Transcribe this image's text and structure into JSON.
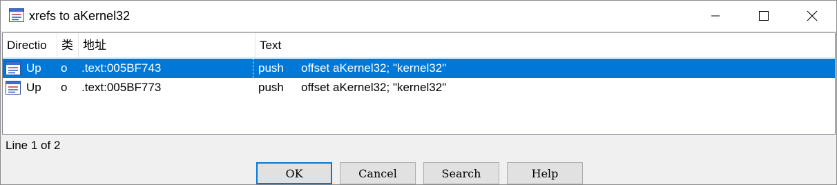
{
  "window": {
    "title": "xrefs to aKernel32",
    "icon": "xref-list-icon"
  },
  "columns": {
    "direction": "Directio",
    "type": "类",
    "address": "地址",
    "text": "Text"
  },
  "rows": [
    {
      "direction": "Up",
      "type": "o",
      "address": ".text:005BF743",
      "op": "push",
      "operand": "offset aKernel32; \"kernel32\"",
      "selected": true
    },
    {
      "direction": "Up",
      "type": "o",
      "address": ".text:005BF773",
      "op": "push",
      "operand": "offset aKernel32; \"kernel32\"",
      "selected": false
    }
  ],
  "status": {
    "line_text": "Line 1 of 2"
  },
  "buttons": {
    "ok": "OK",
    "cancel": "Cancel",
    "search": "Search",
    "help": "Help"
  },
  "colors": {
    "selection": "#0078d7",
    "default_button_border": "#0078d7"
  }
}
